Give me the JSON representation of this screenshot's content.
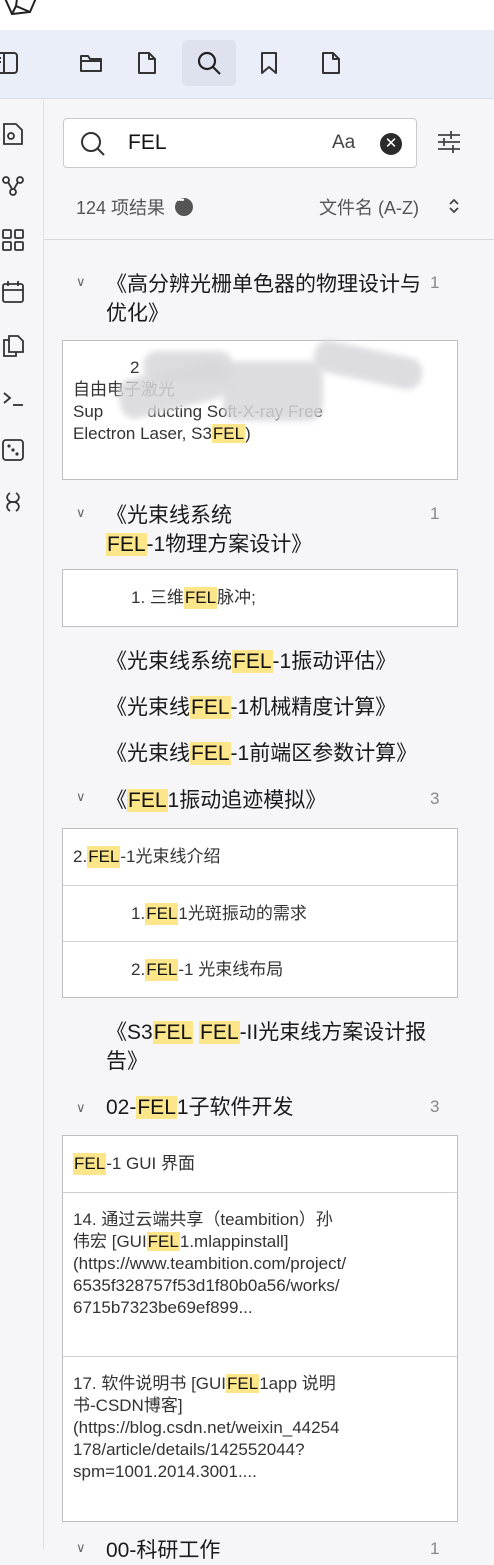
{
  "tabs": [
    "files-icon",
    "file-icon",
    "search-icon",
    "bookmark-icon",
    "file-icon"
  ],
  "ribbon": [
    "open-quick-switcher-icon",
    "graph-view-icon",
    "canvas-icon",
    "calendar-icon",
    "copy-icon",
    "terminal-icon",
    "random-note-icon",
    "plugin-icon"
  ],
  "search": {
    "value": "FEL",
    "match_case_label": "Aa",
    "clear_symbol": "✕"
  },
  "results": {
    "count_label": "124 项结果",
    "sort_label": "文件名 (A-Z)",
    "sort_chevron": "⌃⌄"
  },
  "highlight_color": "#fde68a",
  "groups": [
    {
      "title": "《高分辨光栅单色器的物理设计与优化》",
      "count": "1",
      "match_lines": [
        "2",
        "自由电子激光",
        "Sup",
        "ducting Soft-X-ray Free",
        "Electron Laser, S3",
        "FEL",
        ")"
      ]
    },
    {
      "title_a": "《光束线系统",
      "title_hl": "FEL",
      "title_b": "-1物理方案设计》",
      "count": "1",
      "matches": [
        {
          "pre": "1. 三维",
          "hl": "FEL",
          "post": "脉冲;"
        }
      ]
    },
    {
      "title_a": "《光束线系统",
      "title_hl": "FEL",
      "title_b": "-1振动评估》"
    },
    {
      "title_a": "《光束线",
      "title_hl": "FEL",
      "title_b": "-1机械精度计算》"
    },
    {
      "title_a": "《光束线",
      "title_hl": "FEL",
      "title_b": "-1前端区参数计算》"
    },
    {
      "title_a": "《",
      "title_hl": "FEL",
      "title_b": "1振动追迹模拟》",
      "count": "3",
      "matches": [
        {
          "pre": "2. ",
          "hl": "FEL",
          "post": "-1光束线介绍"
        },
        {
          "pre": "1. ",
          "hl": "FEL",
          "post": "1光斑振动的需求"
        },
        {
          "pre": "2. ",
          "hl": "FEL",
          "post": "-1 光束线布局"
        }
      ]
    },
    {
      "title_a": "《S3",
      "title_hl": "FEL",
      "title_mid": " ",
      "title_hl2": "FEL",
      "title_b": "-II光束线方案设计报告》"
    },
    {
      "title_a": "02-",
      "title_hl": "FEL",
      "title_b": "1子软件开发",
      "count": "3",
      "matches": [
        {
          "pre": "",
          "hl": "FEL",
          "post": "-1 GUI 界面"
        },
        {
          "line1_pre": "14. 通过云端共享（teambition）孙",
          "line2_pre": "伟宏 [GUI",
          "hl": "FEL",
          "line2_post": "1.mlappinstall]",
          "line3": "(https://www.teambition.com/project/",
          "line4": "6535f328757f53d1f80b0a56/works/",
          "line5": "6715b7323be69ef899..."
        },
        {
          "line1_pre": "17.   软件说明书 [GUI",
          "hl": "FEL",
          "line1_post": "1app 说明",
          "line2": "书-CSDN博客]",
          "line3": "(https://blog.csdn.net/weixin_44254",
          "line4": "178/article/details/142552044?",
          "line5": "spm=1001.2014.3001...."
        }
      ]
    },
    {
      "title": "00-科研工作",
      "count": "1"
    }
  ]
}
